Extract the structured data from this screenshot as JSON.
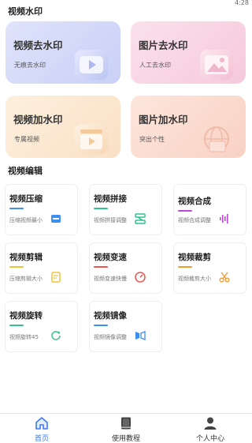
{
  "status": {
    "time": "4:28"
  },
  "watermark": {
    "title": "视频水印",
    "cards": [
      {
        "title": "视频去水印",
        "subtitle": "无痕去水印"
      },
      {
        "title": "图片去水印",
        "subtitle": "人工去水印"
      },
      {
        "title": "视频加水印",
        "subtitle": "专属视频"
      },
      {
        "title": "图片加水印",
        "subtitle": "突出个性"
      }
    ]
  },
  "editing": {
    "title": "视频编辑",
    "tools": [
      {
        "title": "视频压缩",
        "subtitle": "压缩视频最小",
        "accent": "#3d8ef0"
      },
      {
        "title": "视频拼接",
        "subtitle": "视频拼接调整",
        "accent": "#2ec38f"
      },
      {
        "title": "视频合成",
        "subtitle": "视频合成调整",
        "accent": "#c04ad8"
      },
      {
        "title": "视频剪辑",
        "subtitle": "压缩剪辑大小",
        "accent": "#f0c23a"
      },
      {
        "title": "视频变速",
        "subtitle": "视频变速快慢",
        "accent": "#e8544e"
      },
      {
        "title": "视频裁剪",
        "subtitle": "视频裁剪大小",
        "accent": "#f29a2e"
      },
      {
        "title": "视频旋转",
        "subtitle": "视频旋转45",
        "accent": "#3bbf8c"
      },
      {
        "title": "视频镜像",
        "subtitle": "视频镜像调整",
        "accent": "#3d8ef0"
      }
    ]
  },
  "tabs": [
    {
      "label": "首页",
      "active": true
    },
    {
      "label": "使用教程",
      "active": false
    },
    {
      "label": "个人中心",
      "active": false
    }
  ],
  "colors": {
    "active_tab": "#3d7bf0",
    "inactive_tab": "#333333"
  }
}
